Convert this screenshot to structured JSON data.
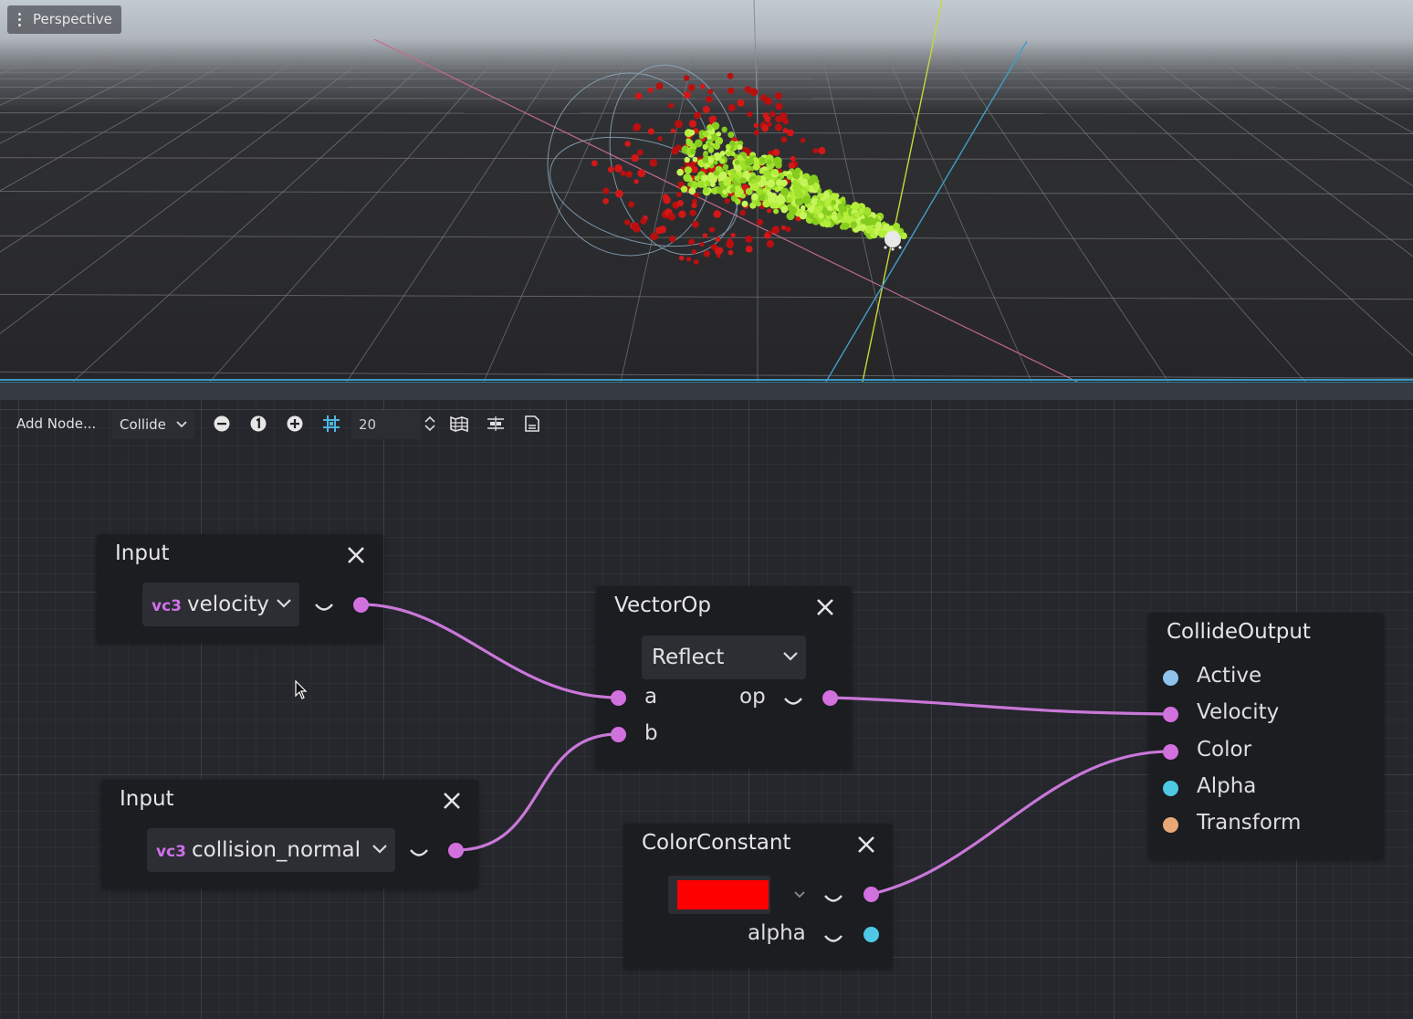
{
  "viewport": {
    "perspective_label": "Perspective"
  },
  "toolbar": {
    "add_node_label": "Add Node...",
    "mode_select": "Collide",
    "snap_value": "20"
  },
  "nodes": {
    "input1": {
      "title": "Input",
      "type_tag": "vc3",
      "value": "velocity"
    },
    "input2": {
      "title": "Input",
      "type_tag": "vc3",
      "value": "collision_normal"
    },
    "vectorop": {
      "title": "VectorOp",
      "operation": "Reflect",
      "port_a": "a",
      "port_b": "b",
      "port_op": "op"
    },
    "colorconstant": {
      "title": "ColorConstant",
      "color_value": "#ff0000",
      "port_alpha": "alpha"
    },
    "collideoutput": {
      "title": "CollideOutput",
      "ports": [
        "Active",
        "Velocity",
        "Color",
        "Alpha",
        "Transform"
      ]
    }
  },
  "colors": {
    "vector_port": "#d46fe0",
    "active_port": "#8fc3ec",
    "alpha_port": "#4fc8e6",
    "transform_port": "#e8a878",
    "edge": "#c977d8",
    "accent": "#3d9ac2"
  },
  "icons": {
    "zoom_out": "zoom-out-icon",
    "zoom_reset": "zoom-reset-icon",
    "zoom_in": "zoom-in-icon",
    "snap": "snap-grid-icon",
    "minimap": "minimap-icon",
    "arrange": "arrange-nodes-icon",
    "script": "script-icon"
  }
}
